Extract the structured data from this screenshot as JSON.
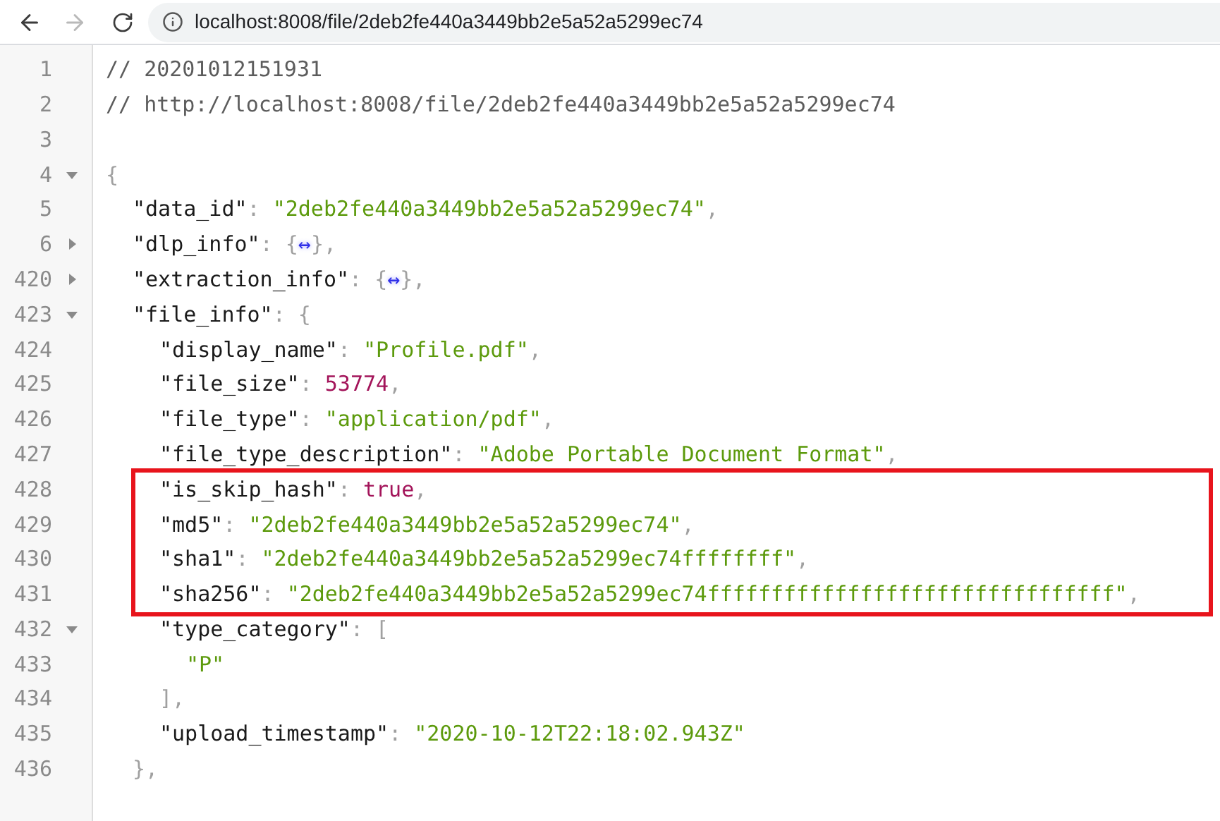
{
  "browser": {
    "back_disabled": false,
    "forward_disabled": true,
    "url": "localhost:8008/file/2deb2fe440a3449bb2e5a52a5299ec74"
  },
  "lines": [
    {
      "number": "1",
      "tokens": [
        {
          "kind": "comment",
          "text": "// 20201012151931"
        }
      ]
    },
    {
      "number": "2",
      "tokens": [
        {
          "kind": "comment",
          "text": "// http://localhost:8008/file/2deb2fe440a3449bb2e5a52a5299ec74"
        }
      ]
    },
    {
      "number": "3"
    },
    {
      "number": "4",
      "expanded": true,
      "tokens": [
        {
          "kind": "punct",
          "text": "{"
        }
      ],
      "children": [
        {
          "number": "5",
          "tokens": [
            {
              "kind": "key",
              "text": "\"data_id\""
            },
            {
              "kind": "punct",
              "text": ": "
            },
            {
              "kind": "string",
              "text": "\"2deb2fe440a3449bb2e5a52a5299ec74\""
            },
            {
              "kind": "punct",
              "text": ","
            }
          ]
        },
        {
          "number": "6",
          "expanded": false,
          "tokens": [
            {
              "kind": "key",
              "text": "\"dlp_info\""
            },
            {
              "kind": "punct",
              "text": ": {"
            },
            {
              "kind": "ellipsis",
              "text": "↔"
            },
            {
              "kind": "punct",
              "text": "},"
            }
          ]
        },
        {
          "number": "420",
          "expanded": false,
          "tokens": [
            {
              "kind": "key",
              "text": "\"extraction_info\""
            },
            {
              "kind": "punct",
              "text": ": {"
            },
            {
              "kind": "ellipsis",
              "text": "↔"
            },
            {
              "kind": "punct",
              "text": "},"
            }
          ]
        },
        {
          "number": "423",
          "expanded": true,
          "tokens": [
            {
              "kind": "key",
              "text": "\"file_info\""
            },
            {
              "kind": "punct",
              "text": ": {"
            }
          ],
          "children": [
            {
              "number": "424",
              "tokens": [
                {
                  "kind": "key",
                  "text": "\"display_name\""
                },
                {
                  "kind": "punct",
                  "text": ": "
                },
                {
                  "kind": "string",
                  "text": "\"Profile.pdf\""
                },
                {
                  "kind": "punct",
                  "text": ","
                }
              ]
            },
            {
              "number": "425",
              "tokens": [
                {
                  "kind": "key",
                  "text": "\"file_size\""
                },
                {
                  "kind": "punct",
                  "text": ": "
                },
                {
                  "kind": "number",
                  "text": "53774"
                },
                {
                  "kind": "punct",
                  "text": ","
                }
              ]
            },
            {
              "number": "426",
              "tokens": [
                {
                  "kind": "key",
                  "text": "\"file_type\""
                },
                {
                  "kind": "punct",
                  "text": ": "
                },
                {
                  "kind": "string",
                  "text": "\"application/pdf\""
                },
                {
                  "kind": "punct",
                  "text": ","
                }
              ]
            },
            {
              "number": "427",
              "tokens": [
                {
                  "kind": "key",
                  "text": "\"file_type_description\""
                },
                {
                  "kind": "punct",
                  "text": ": "
                },
                {
                  "kind": "string",
                  "text": "\"Adobe Portable Document Format\""
                },
                {
                  "kind": "punct",
                  "text": ","
                }
              ]
            },
            {
              "number": "428",
              "highlighted": true,
              "tokens": [
                {
                  "kind": "key",
                  "text": "\"is_skip_hash\""
                },
                {
                  "kind": "punct",
                  "text": ": "
                },
                {
                  "kind": "number",
                  "text": "true"
                },
                {
                  "kind": "punct",
                  "text": ","
                }
              ]
            },
            {
              "number": "429",
              "highlighted": true,
              "tokens": [
                {
                  "kind": "key",
                  "text": "\"md5\""
                },
                {
                  "kind": "punct",
                  "text": ": "
                },
                {
                  "kind": "string",
                  "text": "\"2deb2fe440a3449bb2e5a52a5299ec74\""
                },
                {
                  "kind": "punct",
                  "text": ","
                }
              ]
            },
            {
              "number": "430",
              "highlighted": true,
              "tokens": [
                {
                  "kind": "key",
                  "text": "\"sha1\""
                },
                {
                  "kind": "punct",
                  "text": ": "
                },
                {
                  "kind": "string",
                  "text": "\"2deb2fe440a3449bb2e5a52a5299ec74ffffffff\""
                },
                {
                  "kind": "punct",
                  "text": ","
                }
              ]
            },
            {
              "number": "431",
              "highlighted": true,
              "tokens": [
                {
                  "kind": "key",
                  "text": "\"sha256\""
                },
                {
                  "kind": "punct",
                  "text": ": "
                },
                {
                  "kind": "string",
                  "text": "\"2deb2fe440a3449bb2e5a52a5299ec74ffffffffffffffffffffffffffffffff\""
                },
                {
                  "kind": "punct",
                  "text": ","
                }
              ]
            },
            {
              "number": "432",
              "expanded": true,
              "tokens": [
                {
                  "kind": "key",
                  "text": "\"type_category\""
                },
                {
                  "kind": "punct",
                  "text": ": ["
                }
              ],
              "children": [
                {
                  "number": "433",
                  "tokens": [
                    {
                      "kind": "string",
                      "text": "\"P\""
                    }
                  ]
                }
              ]
            },
            {
              "number": "434",
              "tokens": [
                {
                  "kind": "punct",
                  "text": "],"
                }
              ]
            },
            {
              "number": "435",
              "tokens": [
                {
                  "kind": "key",
                  "text": "\"upload_timestamp\""
                },
                {
                  "kind": "punct",
                  "text": ": "
                },
                {
                  "kind": "string",
                  "text": "\"2020-10-12T22:18:02.943Z\""
                }
              ]
            }
          ]
        },
        {
          "number": "436",
          "tokens": [
            {
              "kind": "punct",
              "text": "},"
            }
          ]
        }
      ]
    }
  ]
}
